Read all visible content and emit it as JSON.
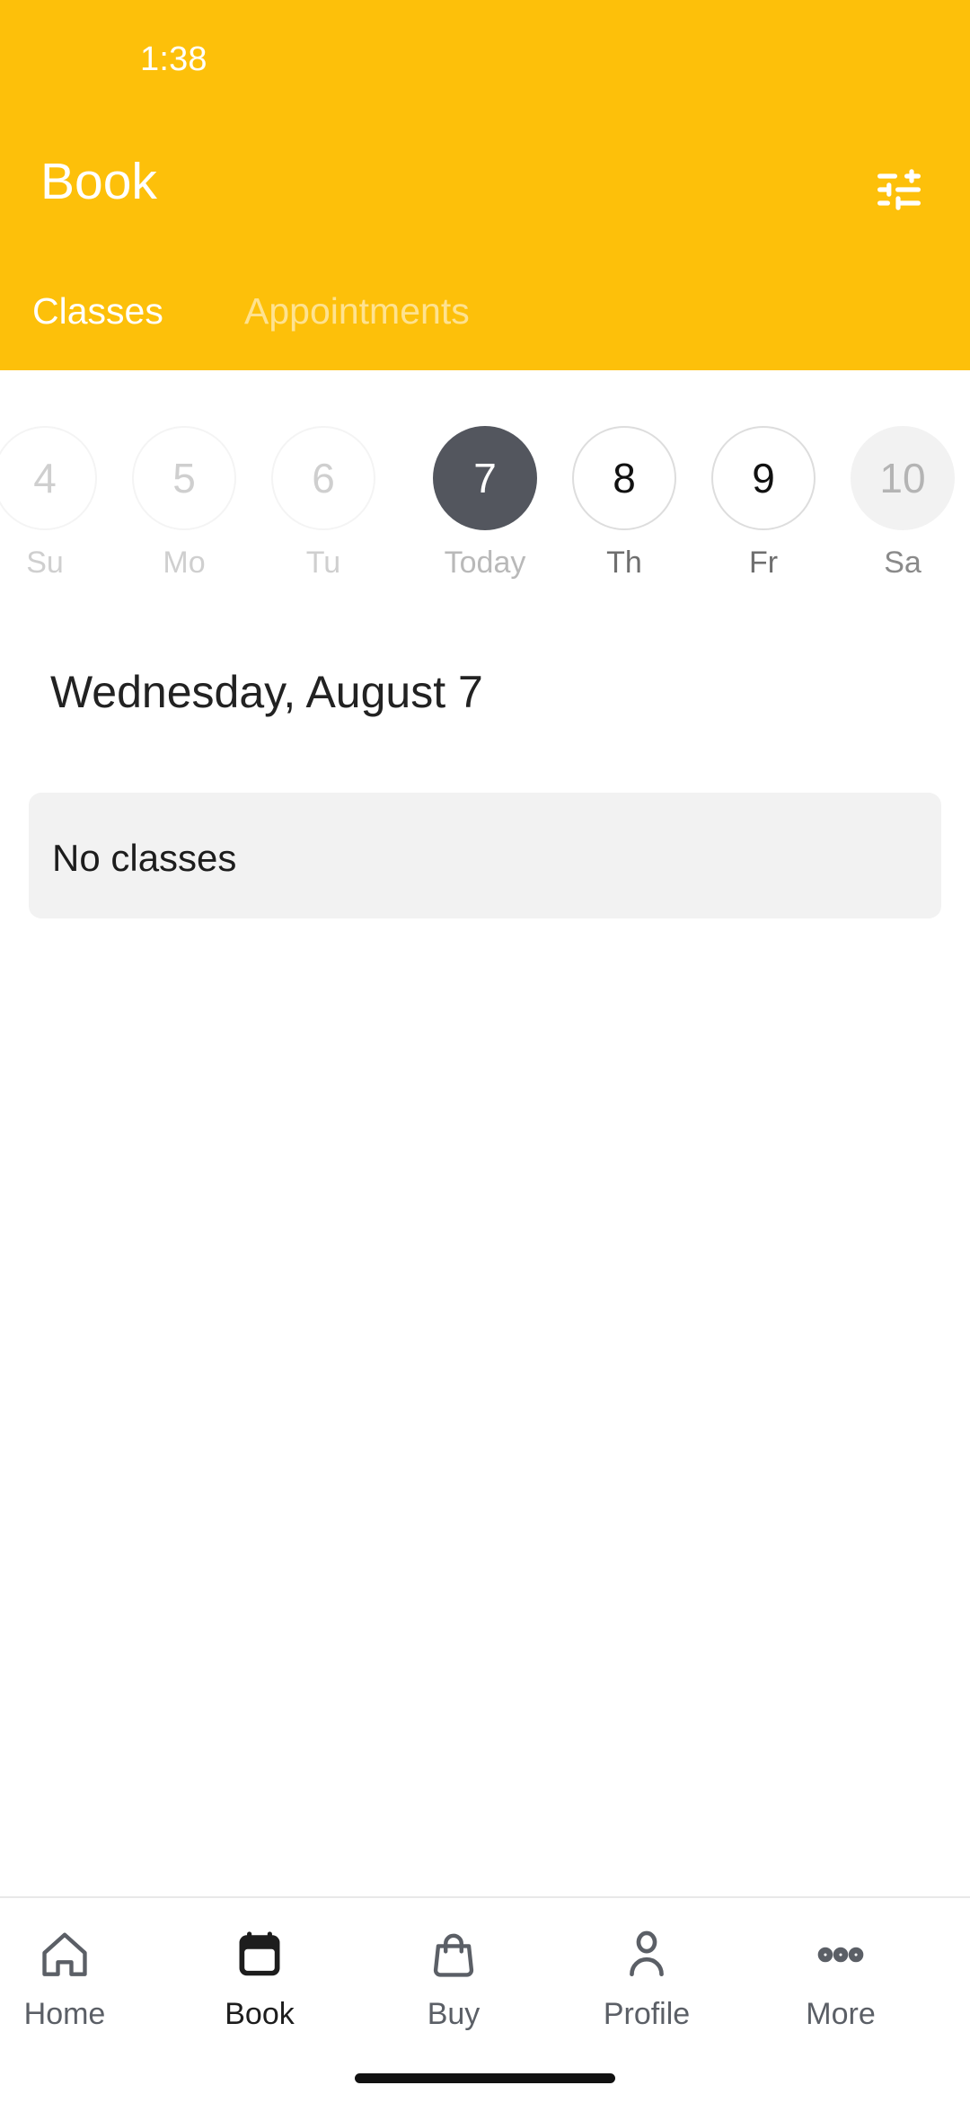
{
  "status_bar": {
    "time": "1:38"
  },
  "header": {
    "title": "Book",
    "filter_icon": "tune-sliders-icon",
    "background_color": "#FDC00A",
    "tabs": [
      {
        "label": "Classes",
        "active": true
      },
      {
        "label": "Appointments",
        "active": false
      }
    ]
  },
  "date_strip": {
    "days": [
      {
        "number": "4",
        "label": "Su",
        "state": "past"
      },
      {
        "number": "5",
        "label": "Mo",
        "state": "past"
      },
      {
        "number": "6",
        "label": "Tu",
        "state": "past"
      },
      {
        "number": "7",
        "label": "Today",
        "state": "today"
      },
      {
        "number": "8",
        "label": "Th",
        "state": "future"
      },
      {
        "number": "9",
        "label": "Fr",
        "state": "future"
      },
      {
        "number": "10",
        "label": "Sa",
        "state": "edge"
      }
    ],
    "selected_color": "#53565E"
  },
  "main": {
    "date_heading": "Wednesday, August 7",
    "empty_state": "No classes"
  },
  "bottom_nav": {
    "items": [
      {
        "label": "Home",
        "icon": "house-icon",
        "active": false
      },
      {
        "label": "Book",
        "icon": "calendar-icon",
        "active": true
      },
      {
        "label": "Buy",
        "icon": "shopping-bag-icon",
        "active": false
      },
      {
        "label": "Profile",
        "icon": "person-icon",
        "active": false
      },
      {
        "label": "More",
        "icon": "ellipsis-icon",
        "active": false
      }
    ]
  }
}
